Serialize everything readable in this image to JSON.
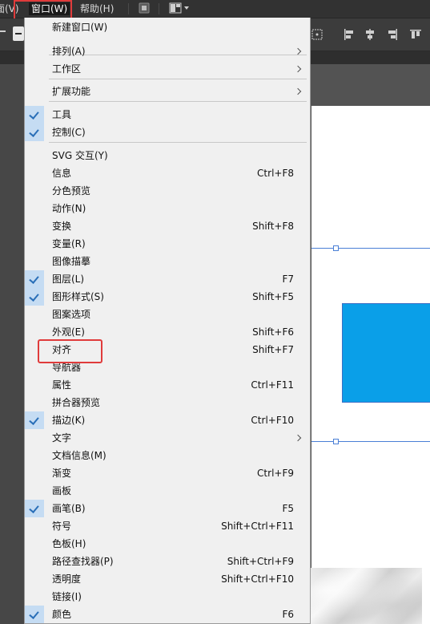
{
  "menubar": {
    "items": [
      {
        "label": "面(V)"
      },
      {
        "label": "窗口(W)"
      },
      {
        "label": "帮助(H)"
      }
    ]
  },
  "window_menu": {
    "items": [
      {
        "label": "新建窗口(W)",
        "shortcut": "",
        "checked": false,
        "submenu": false
      },
      {
        "label": "排列(A)",
        "shortcut": "",
        "checked": false,
        "submenu": true
      },
      {
        "label": "工作区",
        "shortcut": "",
        "checked": false,
        "submenu": true
      },
      {
        "label": "扩展功能",
        "shortcut": "",
        "checked": false,
        "submenu": true
      },
      {
        "label": "工具",
        "shortcut": "",
        "checked": true,
        "submenu": false
      },
      {
        "label": "控制(C)",
        "shortcut": "",
        "checked": true,
        "submenu": false
      },
      {
        "label": "SVG 交互(Y)",
        "shortcut": "",
        "checked": false,
        "submenu": false
      },
      {
        "label": "信息",
        "shortcut": "Ctrl+F8",
        "checked": false,
        "submenu": false
      },
      {
        "label": "分色预览",
        "shortcut": "",
        "checked": false,
        "submenu": false
      },
      {
        "label": "动作(N)",
        "shortcut": "",
        "checked": false,
        "submenu": false
      },
      {
        "label": "变换",
        "shortcut": "Shift+F8",
        "checked": false,
        "submenu": false
      },
      {
        "label": "变量(R)",
        "shortcut": "",
        "checked": false,
        "submenu": false
      },
      {
        "label": "图像描摹",
        "shortcut": "",
        "checked": false,
        "submenu": false
      },
      {
        "label": "图层(L)",
        "shortcut": "F7",
        "checked": true,
        "submenu": false
      },
      {
        "label": "图形样式(S)",
        "shortcut": "Shift+F5",
        "checked": true,
        "submenu": false
      },
      {
        "label": "图案选项",
        "shortcut": "",
        "checked": false,
        "submenu": false
      },
      {
        "label": "外观(E)",
        "shortcut": "Shift+F6",
        "checked": false,
        "submenu": false
      },
      {
        "label": "对齐",
        "shortcut": "Shift+F7",
        "checked": false,
        "submenu": false
      },
      {
        "label": "导航器",
        "shortcut": "",
        "checked": false,
        "submenu": false
      },
      {
        "label": "属性",
        "shortcut": "Ctrl+F11",
        "checked": false,
        "submenu": false
      },
      {
        "label": "拼合器预览",
        "shortcut": "",
        "checked": false,
        "submenu": false
      },
      {
        "label": "描边(K)",
        "shortcut": "Ctrl+F10",
        "checked": true,
        "submenu": false
      },
      {
        "label": "文字",
        "shortcut": "",
        "checked": false,
        "submenu": true
      },
      {
        "label": "文档信息(M)",
        "shortcut": "",
        "checked": false,
        "submenu": false
      },
      {
        "label": "渐变",
        "shortcut": "Ctrl+F9",
        "checked": false,
        "submenu": false
      },
      {
        "label": "画板",
        "shortcut": "",
        "checked": false,
        "submenu": false
      },
      {
        "label": "画笔(B)",
        "shortcut": "F5",
        "checked": true,
        "submenu": false
      },
      {
        "label": "符号",
        "shortcut": "Shift+Ctrl+F11",
        "checked": false,
        "submenu": false
      },
      {
        "label": "色板(H)",
        "shortcut": "",
        "checked": false,
        "submenu": false
      },
      {
        "label": "路径查找器(P)",
        "shortcut": "Shift+Ctrl+F9",
        "checked": false,
        "submenu": false
      },
      {
        "label": "透明度",
        "shortcut": "Shift+Ctrl+F10",
        "checked": false,
        "submenu": false
      },
      {
        "label": "链接(I)",
        "shortcut": "",
        "checked": false,
        "submenu": false
      },
      {
        "label": "颜色",
        "shortcut": "F6",
        "checked": true,
        "submenu": false
      }
    ]
  },
  "colors": {
    "accent_highlight": "#e03b3b",
    "check_background": "#c5dcf3",
    "canvas_object": "#0a9fe8"
  }
}
